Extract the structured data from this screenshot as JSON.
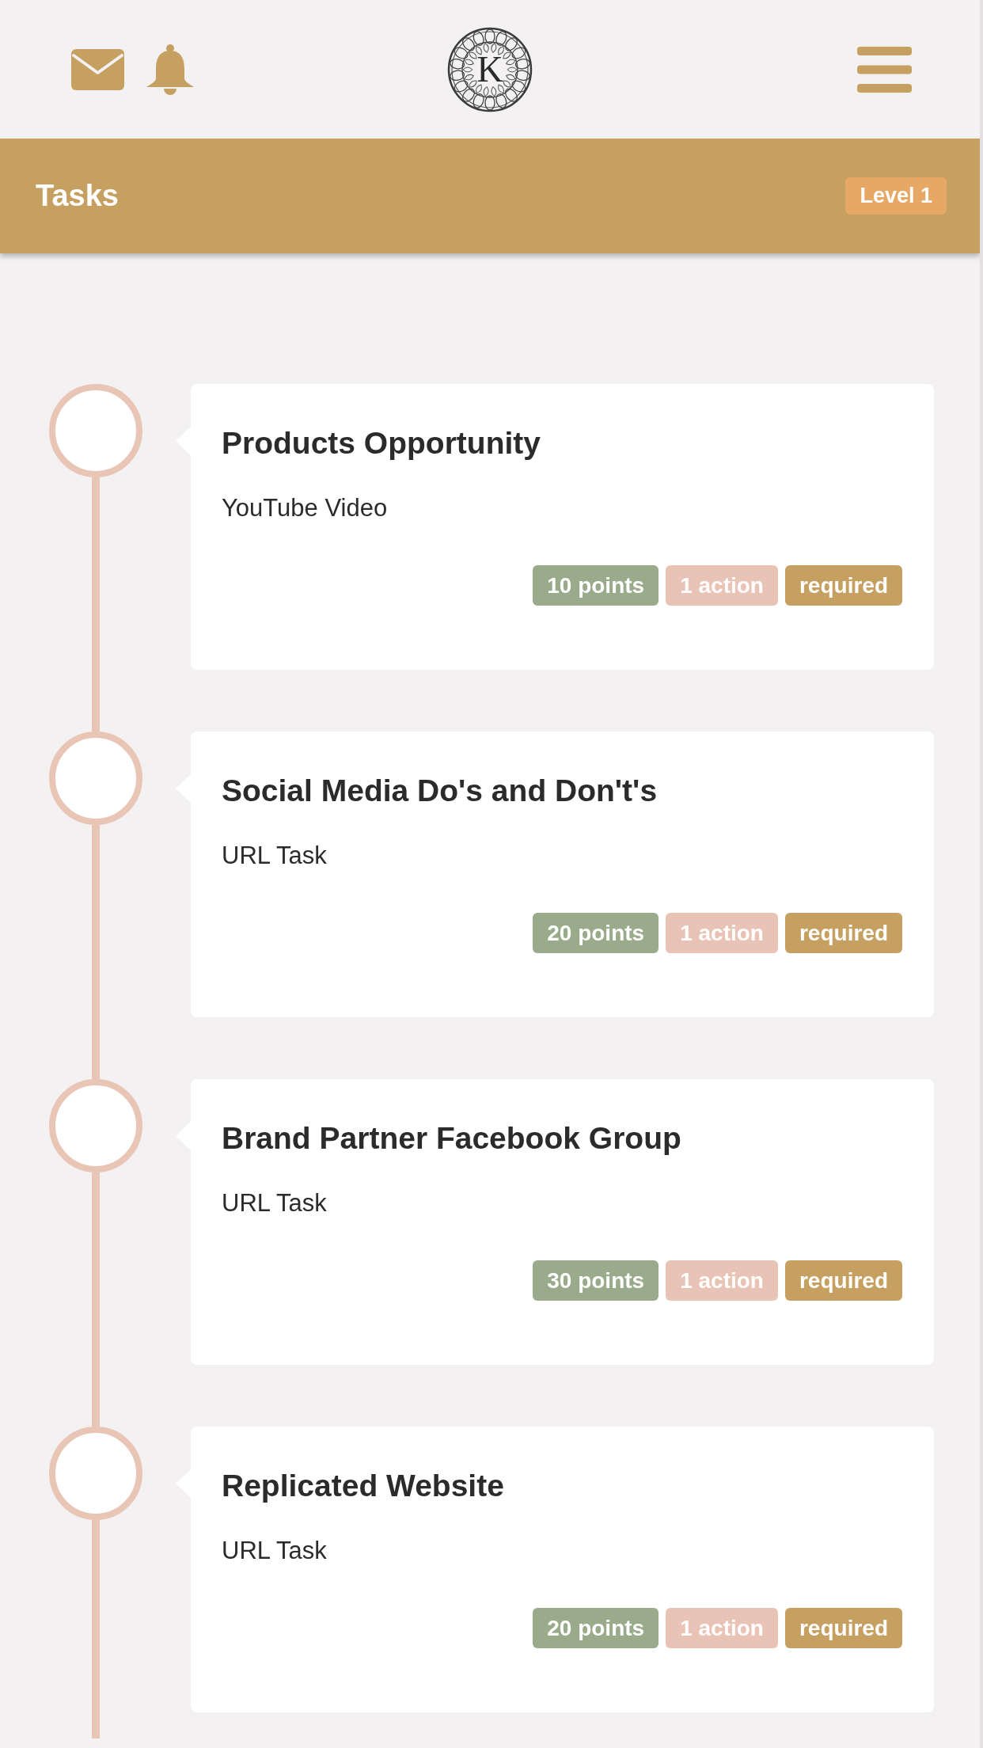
{
  "header": {
    "logo": {
      "letter": "K"
    }
  },
  "title_bar": {
    "title": "Tasks",
    "badge": "Level 1"
  },
  "tasks": [
    {
      "title": "Products Opportunity",
      "type": "YouTube Video",
      "tags": [
        {
          "label": "10 points",
          "color": "#9aab8c"
        },
        {
          "label": "1 action",
          "color": "#e9c4b6"
        },
        {
          "label": "required",
          "color": "#c6a060"
        }
      ]
    },
    {
      "title": "Social Media Do's and Don't's",
      "type": "URL Task",
      "tags": [
        {
          "label": "20 points",
          "color": "#9aab8c"
        },
        {
          "label": "1 action",
          "color": "#e9c4b6"
        },
        {
          "label": "required",
          "color": "#c6a060"
        }
      ]
    },
    {
      "title": "Brand Partner Facebook Group",
      "type": "URL Task",
      "tags": [
        {
          "label": "30 points",
          "color": "#9aab8c"
        },
        {
          "label": "1 action",
          "color": "#e9c4b6"
        },
        {
          "label": "required",
          "color": "#c6a060"
        }
      ]
    },
    {
      "title": "Replicated Website",
      "type": "URL Task",
      "tags": [
        {
          "label": "20 points",
          "color": "#9aab8c"
        },
        {
          "label": "1 action",
          "color": "#e9c4b6"
        },
        {
          "label": "required",
          "color": "#c6a060"
        }
      ]
    }
  ]
}
